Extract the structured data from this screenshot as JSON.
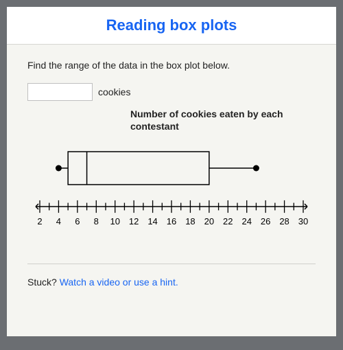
{
  "header": {
    "title": "Reading box plots"
  },
  "question": {
    "prompt": "Find the range of the data in the box plot below.",
    "unit": "cookies",
    "answer_value": ""
  },
  "chart_data": {
    "type": "boxplot",
    "title": "Number of cookies eaten by each contestant",
    "xlabel": "",
    "ylabel": "",
    "min": 4,
    "q1": 5,
    "median": 7,
    "q3": 20,
    "max": 25,
    "axis": {
      "min": 2,
      "max": 30,
      "tick_major": 2,
      "tick_minor": 1,
      "labels": [
        2,
        4,
        6,
        8,
        10,
        12,
        14,
        16,
        18,
        20,
        22,
        24,
        26,
        28,
        30
      ]
    }
  },
  "hint": {
    "stuck_label": "Stuck?",
    "link_text": "Watch a video or use a hint."
  }
}
